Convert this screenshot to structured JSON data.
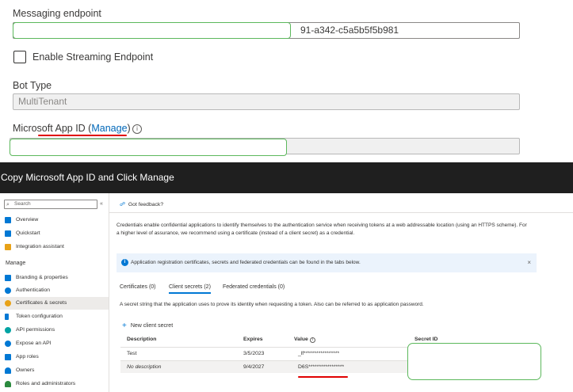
{
  "top": {
    "messaging_label": "Messaging endpoint",
    "messaging_value": "91-a342-c5a5b5f5b981",
    "streaming_label": "Enable Streaming Endpoint",
    "bot_type_label": "Bot Type",
    "bot_type_value": "MultiTenant",
    "app_id_prefix": "Microsoft App ID (",
    "app_id_link": "Manage",
    "app_id_suffix": ")",
    "info_glyph": "i"
  },
  "caption": "Copy Microsoft App ID and Click Manage",
  "portal": {
    "search_placeholder": "Search",
    "collapse_glyph": "«",
    "nav_top": [
      {
        "label": "Overview",
        "icon": "overview-icon",
        "color": "#0078d4"
      },
      {
        "label": "Quickstart",
        "icon": "quickstart-icon",
        "color": "#0078d4"
      },
      {
        "label": "Integration assistant",
        "icon": "rocket-icon",
        "color": "#e8a218"
      }
    ],
    "manage_heading": "Manage",
    "nav_manage": [
      {
        "label": "Branding & properties",
        "icon": "branding-icon",
        "color": "#0078d4"
      },
      {
        "label": "Authentication",
        "icon": "authentication-icon",
        "color": "#0078d4"
      },
      {
        "label": "Certificates & secrets",
        "icon": "key-icon",
        "color": "#e8a218",
        "active": true
      },
      {
        "label": "Token configuration",
        "icon": "token-icon",
        "color": "#0078d4"
      },
      {
        "label": "API permissions",
        "icon": "api-permissions-icon",
        "color": "#00a3a3"
      },
      {
        "label": "Expose an API",
        "icon": "cloud-icon",
        "color": "#0078d4"
      },
      {
        "label": "App roles",
        "icon": "app-roles-icon",
        "color": "#0078d4"
      },
      {
        "label": "Owners",
        "icon": "owners-icon",
        "color": "#0078d4"
      },
      {
        "label": "Roles and administrators",
        "icon": "roles-icon",
        "color": "#2b8a3e"
      }
    ],
    "feedback": "Got feedback?",
    "description": "Credentials enable confidential applications to identify themselves to the authentication service when receiving tokens at a web addressable location (using an HTTPS scheme). For a higher level of assurance, we recommend using a certificate (instead of a client secret) as a credential.",
    "info_bar": "Application registration certificates, secrets and federated credentials can be found in the tabs below.",
    "info_close": "×",
    "tabs": [
      {
        "label": "Certificates (0)"
      },
      {
        "label": "Client secrets (2)",
        "active": true
      },
      {
        "label": "Federated credentials (0)"
      }
    ],
    "subtitle": "A secret string that the application uses to prove its identity when requesting a token. Also can be referred to as application password.",
    "new_secret": "New client secret",
    "columns": {
      "description": "Description",
      "expires": "Expires",
      "value": "Value",
      "secret_id": "Secret ID"
    },
    "rows": [
      {
        "description": "Test",
        "expires": "3/5/2023",
        "value": "_lf*****************"
      },
      {
        "description": "No description",
        "expires": "9/4/2027",
        "value": "D6S*****************"
      }
    ]
  },
  "colors": {
    "accent": "#0078d4",
    "annotation_red": "#e00000",
    "annotation_green": "#5cb85c"
  }
}
